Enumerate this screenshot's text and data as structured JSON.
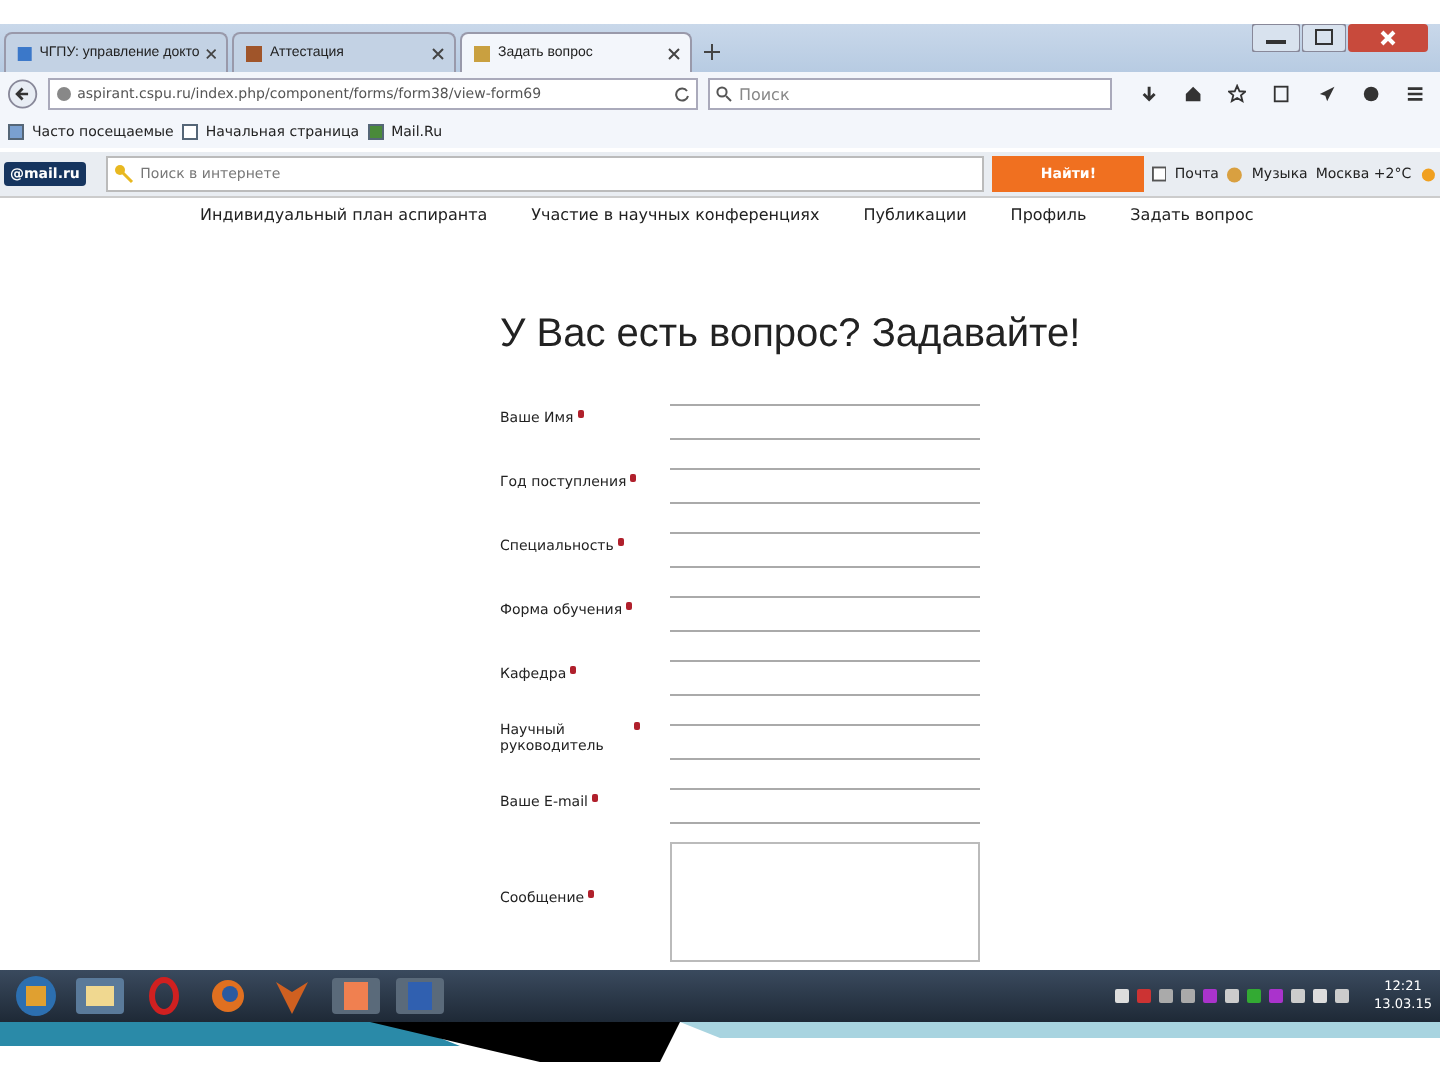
{
  "browser": {
    "tabs": [
      {
        "label": "ЧГПУ: управление докто",
        "selected": false
      },
      {
        "label": "Аттестация",
        "selected": false
      },
      {
        "label": "Задать вопрос",
        "selected": true
      }
    ],
    "address": "aspirant.cspu.ru/index.php/component/forms/form38/view-form69",
    "search_placeholder": "Поиск",
    "bookmarks": [
      "Часто посещаемые",
      "Начальная страница",
      "Mail.Ru"
    ]
  },
  "mail_toolbar": {
    "logo": "@mail.ru",
    "search_placeholder": "Поиск в интернете",
    "button": "Найти!",
    "mail": "Почта",
    "music": "Музыка",
    "weather": "Москва +2°C"
  },
  "site_nav": [
    "Индивидуальный план аспиранта",
    "Участие в научных конференциях",
    "Публикации",
    "Профиль",
    "Задать вопрос"
  ],
  "form": {
    "title": "У Вас есть вопрос? Задавайте!",
    "fields": [
      {
        "label": "Ваше Имя",
        "required": true,
        "kind": "text"
      },
      {
        "label": "Год поступления",
        "required": true,
        "kind": "text"
      },
      {
        "label": "Специальность",
        "required": true,
        "kind": "text"
      },
      {
        "label": "Форма обучения",
        "required": true,
        "kind": "text"
      },
      {
        "label": "Кафедра",
        "required": true,
        "kind": "text"
      },
      {
        "label": "Научный руководитель",
        "required": true,
        "kind": "text"
      },
      {
        "label": "Ваше E-mail",
        "required": true,
        "kind": "text"
      },
      {
        "label": "Сообщение",
        "required": true,
        "kind": "textarea"
      }
    ]
  },
  "taskbar": {
    "time": "12:21",
    "date": "13.03.15"
  }
}
